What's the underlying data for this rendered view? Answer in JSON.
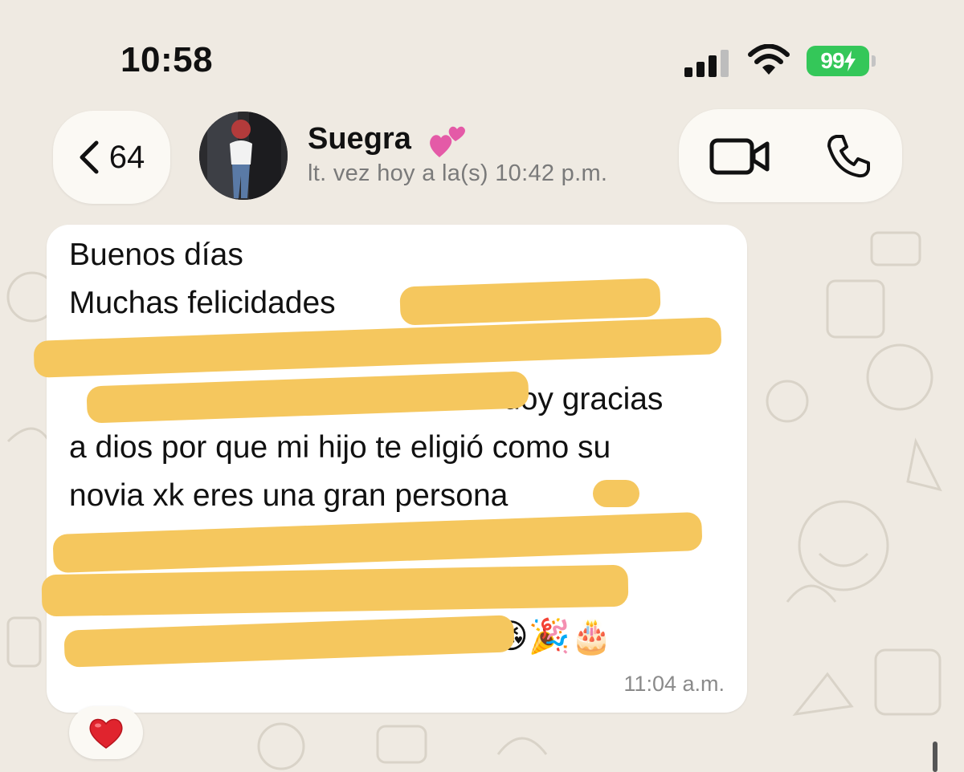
{
  "status_bar": {
    "time": "10:58",
    "battery": "99",
    "colors": {
      "battery": "#34c759"
    }
  },
  "header": {
    "back_count": "64",
    "contact_name": "Suegra",
    "name_emoji": "💕",
    "last_seen": "lt. vez hoy a la(s) 10:42 p.m."
  },
  "message": {
    "lines": [
      "Buenos días",
      "Muchas felicidades",
      "",
      "doy gracias",
      "a dios por que mi hijo te eligió como su",
      "novia xk eres una gran persona",
      "",
      "",
      "😘🎉🎂"
    ],
    "time": "11:04 a.m."
  },
  "reaction": {
    "emoji": "❤️"
  },
  "icons": [
    "chevron-left-icon",
    "video-camera-icon",
    "phone-icon",
    "signal-icon",
    "wifi-icon",
    "battery-icon"
  ]
}
